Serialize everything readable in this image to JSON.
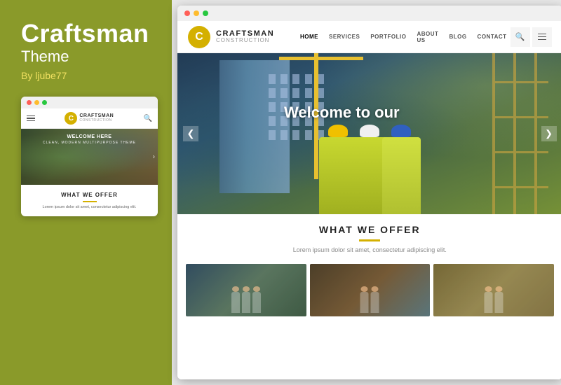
{
  "left": {
    "title": "Craftsman",
    "subtitle": "Theme",
    "author": "By ljube77"
  },
  "mini_browser": {
    "logo_letter": "C",
    "logo_main": "CRAFTSMAN",
    "logo_sub": "CONSTRUCTION",
    "hero_text": "WELCOME HERE",
    "hero_sub": "CLEAN, MODERN MULTIPURPOSE THEME",
    "offer_title": "WHAT WE OFFER",
    "offer_text": "Lorem ipsum dolor sit amet, consectetur adipiscing elit."
  },
  "big_browser": {
    "logo_letter": "C",
    "logo_main": "CRAFTSMAN",
    "logo_sub": "CONSTRUCTION",
    "nav": {
      "home": "HOME",
      "services": "SERVICES",
      "portfolio": "PORTFOLIO",
      "about": "ABOUT US",
      "blog": "BLOG",
      "contact": "CONTACT"
    },
    "hero_welcome": "Welcome to our",
    "offer_title": "WHAT WE OFFER",
    "offer_text": "Lorem ipsum dolor sit amet, consectetur adipiscing elit.",
    "prev_arrow": "❮",
    "next_arrow": "❯",
    "search_icon": "🔍",
    "menu_icon": "☰"
  },
  "colors": {
    "accent": "#d4b000",
    "green_bg": "#8a9a2a",
    "text_white": "#ffffff"
  }
}
